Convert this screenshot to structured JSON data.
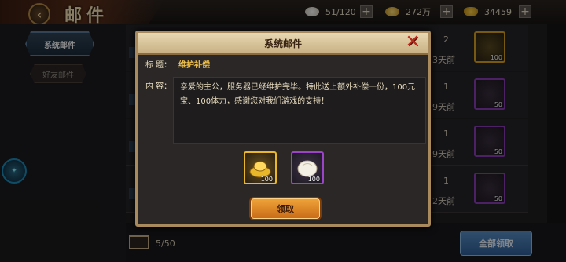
{
  "header": {
    "title": "邮件"
  },
  "resources": [
    {
      "icon": "stamina-bun-icon",
      "value": "51/120"
    },
    {
      "icon": "gold-coin-icon",
      "value": "272万"
    },
    {
      "icon": "yuanbao-icon",
      "value": "34459"
    }
  ],
  "sidebar": {
    "tabs": [
      {
        "label": "系统邮件",
        "active": true
      },
      {
        "label": "好友邮件",
        "active": false
      }
    ],
    "badge_icon": "event-badge-icon"
  },
  "mail_list": [
    {
      "count": "2",
      "days": "3天前",
      "item": {
        "type": "yuanbao",
        "qty": "100"
      }
    },
    {
      "count": "1",
      "days": "9天前",
      "item": {
        "type": "bun",
        "qty": "50"
      }
    },
    {
      "count": "1",
      "days": "9天前",
      "item": {
        "type": "bun",
        "qty": "50"
      }
    },
    {
      "count": "1",
      "days": "2天前",
      "item": {
        "type": "bun",
        "qty": "50"
      }
    }
  ],
  "footer": {
    "mail_count": "5/50",
    "claim_all_label": "全部领取"
  },
  "modal": {
    "title": "系统邮件",
    "subject_label": "标 题：",
    "subject": "维护补偿",
    "content_label": "内 容：",
    "content": "亲爱的主公，服务器已经维护完毕。特此送上额外补偿一份，100元宝、100体力，感谢您对我们游戏的支持！",
    "rewards": [
      {
        "type": "yuanbao",
        "qty": "100"
      },
      {
        "type": "bun",
        "qty": "100"
      }
    ],
    "claim_label": "领取"
  },
  "colors": {
    "accent_gold": "#f0c04a",
    "modal_border": "#a88a5c",
    "claim_orange": "#e8922c",
    "claim_all_blue": "#4a7fbf",
    "quality_gold": "#e8b82a",
    "quality_purple": "#9a44c8"
  }
}
